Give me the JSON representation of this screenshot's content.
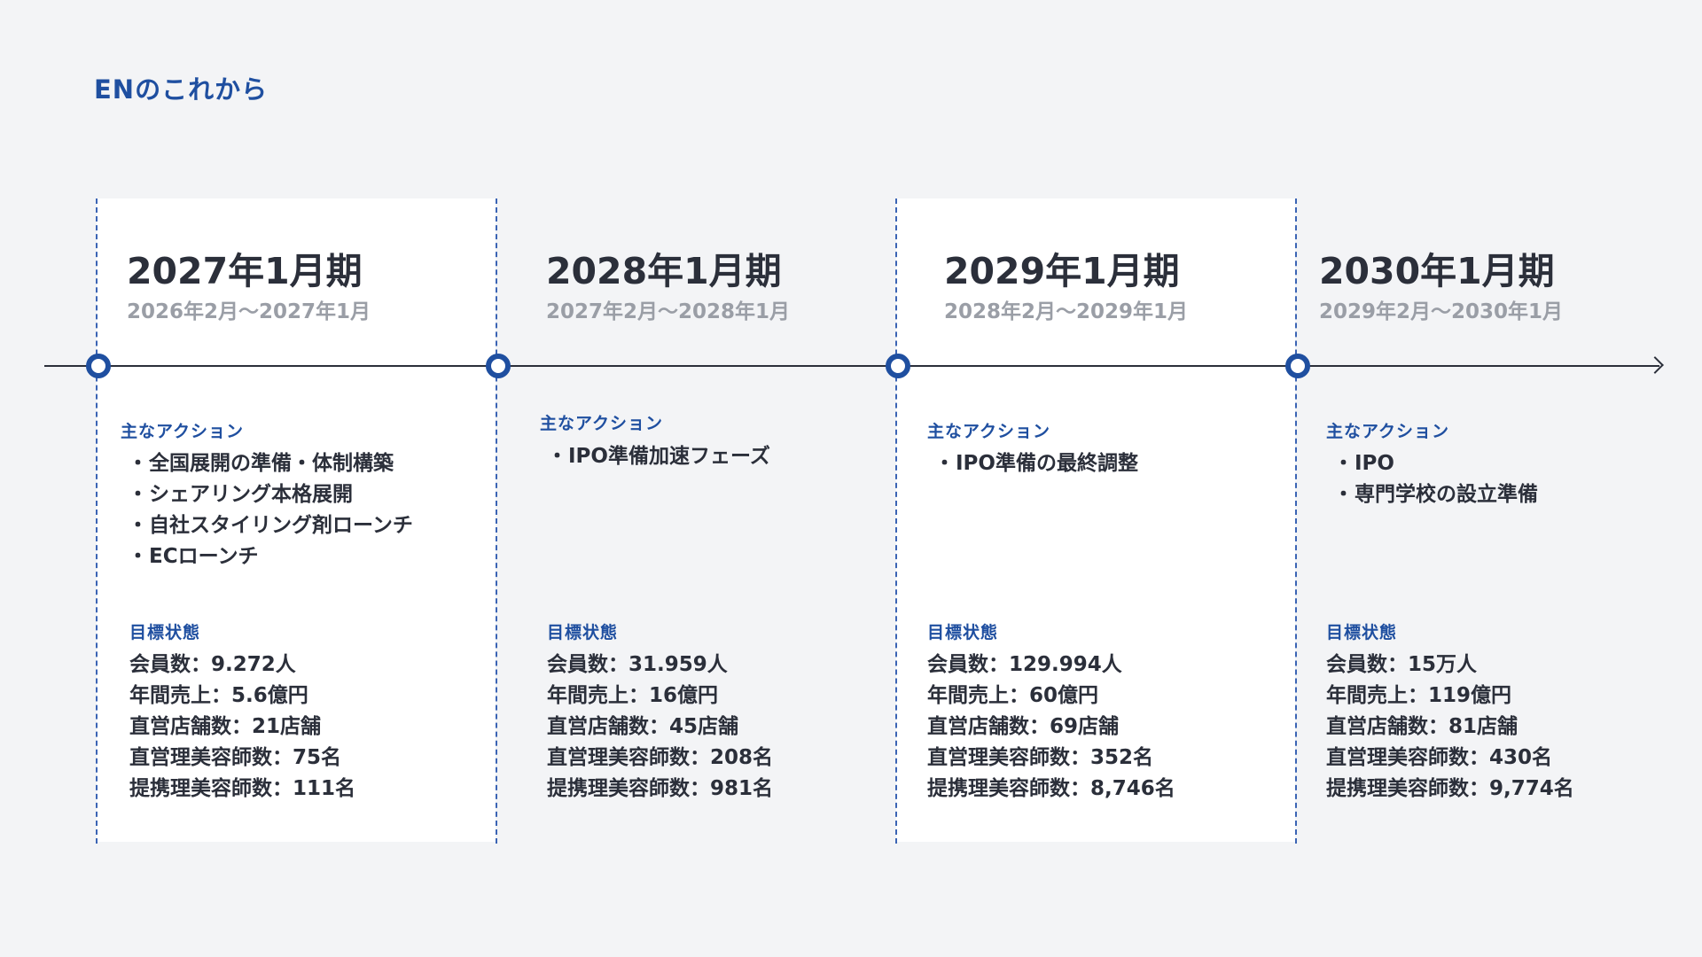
{
  "page_title": "ENのこれから",
  "action_heading": "主なアクション",
  "target_heading": "目標状態",
  "bullet_glyph": "・",
  "periods": [
    {
      "title": "2027年1月期",
      "range": "2026年2月～2027年1月",
      "actions": [
        "全国展開の準備・体制構築",
        "シェアリング本格展開",
        "自社スタイリング剤ローンチ",
        "ECローンチ"
      ],
      "targets": [
        "会員数：9.272人",
        "年間売上：5.6億円",
        "直営店舗数：21店舗",
        "直営理美容師数：75名",
        "提携理美容師数：111名"
      ]
    },
    {
      "title": "2028年1月期",
      "range": "2027年2月～2028年1月",
      "actions": [
        "IPO準備加速フェーズ"
      ],
      "targets": [
        "会員数：31.959人",
        "年間売上：16億円",
        "直営店舗数：45店舗",
        "直営理美容師数：208名",
        "提携理美容師数：981名"
      ]
    },
    {
      "title": "2029年1月期",
      "range": "2028年2月～2029年1月",
      "actions": [
        "IPO準備の最終調整"
      ],
      "targets": [
        "会員数：129.994人",
        "年間売上：60億円",
        "直営店舗数：69店舗",
        "直営理美容師数：352名",
        "提携理美容師数：8,746名"
      ]
    },
    {
      "title": "2030年1月期",
      "range": "2029年2月～2030年1月",
      "actions": [
        "IPO",
        "専門学校の設立準備"
      ],
      "targets": [
        "会員数：15万人",
        "年間売上：119億円",
        "直営店舗数：81店舗",
        "直営理美容師数：430名",
        "提携理美容師数：9,774名"
      ]
    }
  ]
}
